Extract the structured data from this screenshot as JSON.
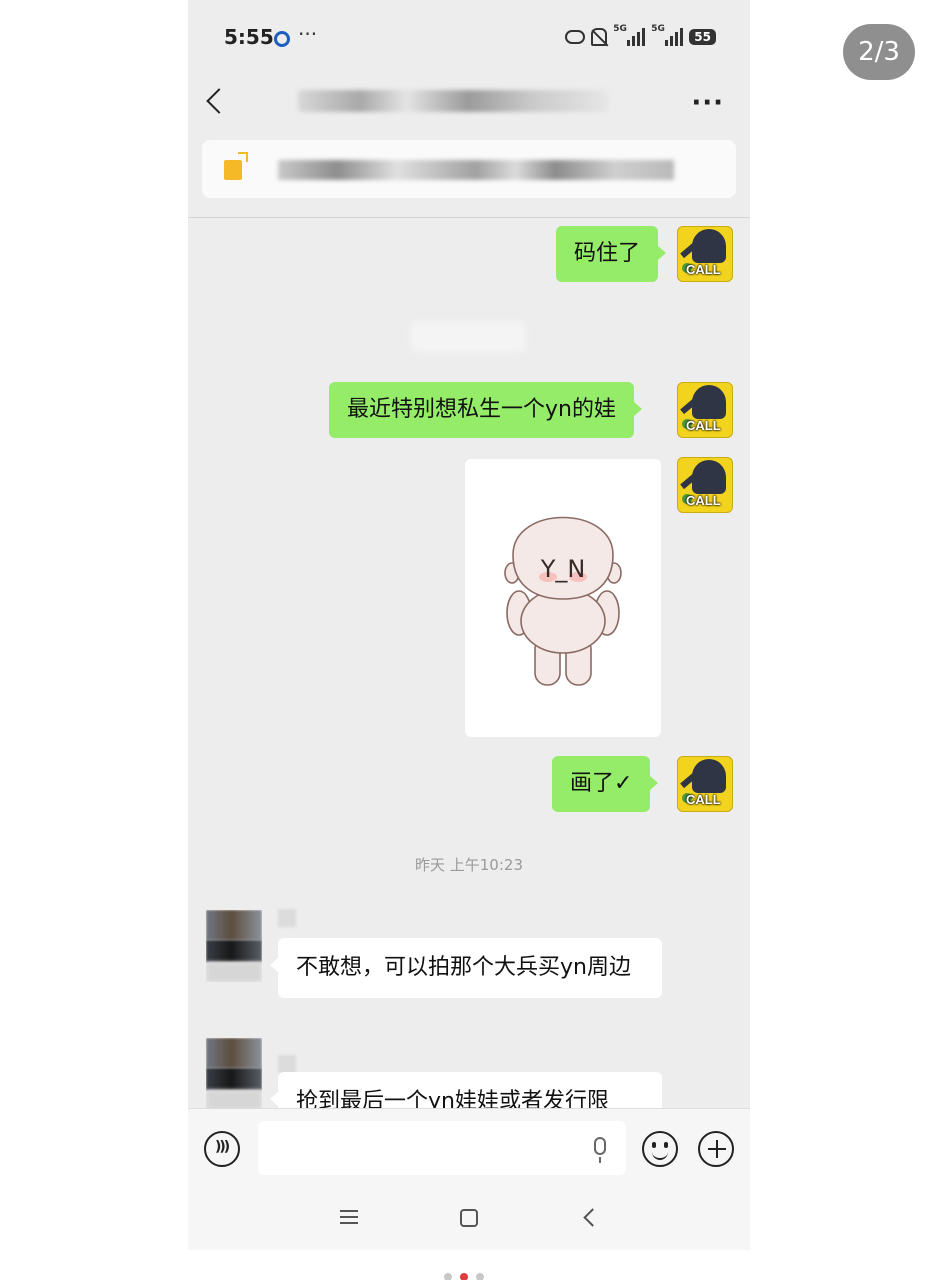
{
  "viewer": {
    "page_counter": "2/3"
  },
  "status_bar": {
    "time": "5:55",
    "more": "···",
    "network_label_1": "5G",
    "network_label_2": "5G",
    "battery": "55"
  },
  "nav": {
    "more": "···"
  },
  "messages": {
    "m1": "码住了",
    "m2": "最近特别想私生一个yn的娃",
    "m3": "画了✓",
    "timestamp": "昨天 上午10:23",
    "m4": "不敢想，可以拍那个大兵买yn周边",
    "m5": "抢到最后一个yn娃娃或者发行限"
  },
  "sticker": {
    "face_text": "Y_N"
  },
  "avatar": {
    "badge": "CALL"
  },
  "icons": {
    "back": "chevron-left-icon",
    "more": "more-dots-icon",
    "notice": "bulb-icon",
    "voice": "voice-icon",
    "mic": "mic-icon",
    "emoji": "emoji-icon",
    "plus": "plus-icon"
  },
  "colors": {
    "bubble_me": "#95ec69",
    "bubble_other": "#ffffff",
    "chat_bg": "#ededed"
  }
}
